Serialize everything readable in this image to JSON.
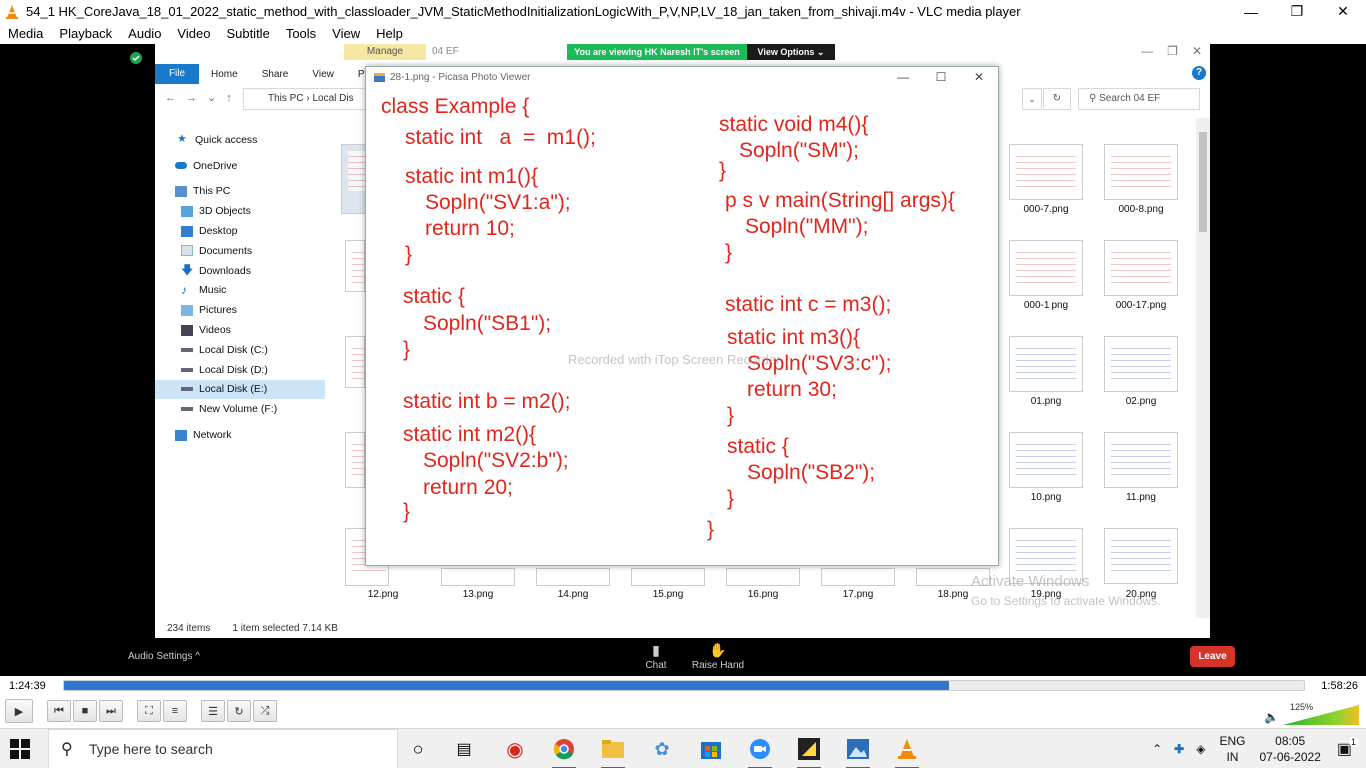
{
  "vlc": {
    "title": "54_1 HK_CoreJava_18_01_2022_static_method_with_classloader_JVM_StaticMethodInitializationLogicWith_P,V,NP,LV_18_jan_taken_from_shivaji.m4v - VLC media player",
    "menu": [
      "Media",
      "Playback",
      "Audio",
      "Video",
      "Subtitle",
      "Tools",
      "View",
      "Help"
    ],
    "time_elapsed": "1:24:39",
    "time_total": "1:58:26",
    "progress": 0.714,
    "volume": "125%",
    "accent": "#2e77d0"
  },
  "share": {
    "manage_tab": "Manage",
    "folder_tab": "04 EF",
    "banner": "You are viewing HK Naresh IT's screen",
    "view_options": "View Options ⌄"
  },
  "explorer": {
    "tabs": [
      "File",
      "Home",
      "Share",
      "View",
      "Pic"
    ],
    "address": "This PC  ›  Local Dis",
    "search_placeholder": "Search 04 EF",
    "nav": [
      {
        "label": "Quick access",
        "icon": "star"
      },
      {
        "label": "OneDrive",
        "icon": "cloud"
      },
      {
        "label": "This PC",
        "icon": "pc"
      },
      {
        "label": "3D Objects",
        "icon": "cube"
      },
      {
        "label": "Desktop",
        "icon": "desktop"
      },
      {
        "label": "Documents",
        "icon": "doc"
      },
      {
        "label": "Downloads",
        "icon": "down"
      },
      {
        "label": "Music",
        "icon": "music"
      },
      {
        "label": "Pictures",
        "icon": "pic"
      },
      {
        "label": "Videos",
        "icon": "video"
      },
      {
        "label": "Local Disk (C:)",
        "icon": "disk"
      },
      {
        "label": "Local Disk (D:)",
        "icon": "disk"
      },
      {
        "label": "Local Disk (E:)",
        "icon": "disk"
      },
      {
        "label": "New Volume (F:)",
        "icon": "disk"
      },
      {
        "label": "Network",
        "icon": "net"
      }
    ],
    "files_right": [
      "000-7.png",
      "000-8.png",
      "000-1 png",
      "000-17.png",
      "01.png",
      "02.png",
      "10.png",
      "11.png",
      "19.png",
      "20.png"
    ],
    "files_bottom": [
      "12.png",
      "13.png",
      "14.png",
      "15.png",
      "16.png",
      "17.png",
      "18.png"
    ],
    "status_items": "234 items",
    "status_selected": "1 item selected  7.14 KB"
  },
  "picasa": {
    "title": "28-1.png - Picasa Photo Viewer",
    "code_left": [
      "class Example {",
      "static int   a  =  m1();",
      "static int m1(){",
      "Sopln(\"SV1:a\");",
      "return 10;",
      "}",
      "static {",
      "Sopln(\"SB1\");",
      "}",
      "static int b = m2();",
      "static int m2(){",
      "Sopln(\"SV2:b\");",
      "return 20;",
      "}"
    ],
    "code_right": [
      "static void m4(){",
      "Sopln(\"SM\");",
      "}",
      "p s v main(String[] args){",
      "Sopln(\"MM\");",
      "}",
      "static int c = m3();",
      "static int m3(){",
      "Sopln(\"SV3:c\");",
      "return 30;",
      "}",
      "static {",
      "Sopln(\"SB2\");",
      "}",
      "}"
    ],
    "code_color": "#e1261c"
  },
  "overlay": {
    "watermark": "Recorded with iTop Screen Recorder",
    "activate_title": "Activate Windows",
    "activate_sub": "Go to Settings to activate Windows."
  },
  "zoom": {
    "audio_settings": "Audio Settings  ^",
    "chat": "Chat",
    "raise_hand": "Raise Hand",
    "leave": "Leave"
  },
  "taskbar": {
    "search_placeholder": "Type here to search",
    "lang_top": "ENG",
    "lang_bottom": "IN",
    "time": "08:05",
    "date": "07-06-2022",
    "notif_count": "1"
  }
}
